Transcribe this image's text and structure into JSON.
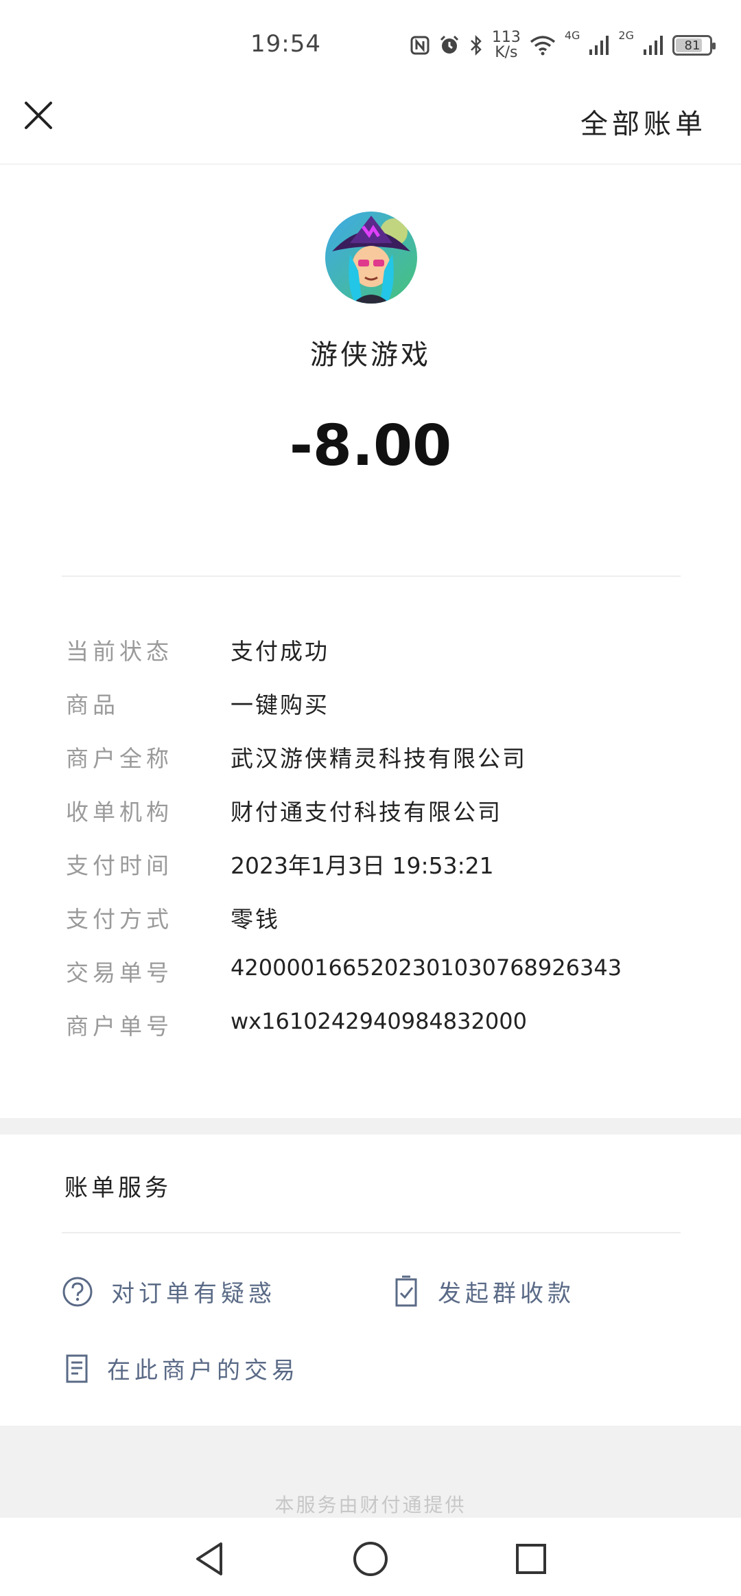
{
  "status_bar": {
    "time": "19:54",
    "net_speed_value": "113",
    "net_speed_unit": "K/s",
    "signal_1_label": "4G",
    "signal_2_label": "2G",
    "battery": "81"
  },
  "nav": {
    "all_bills": "全部账单"
  },
  "header": {
    "merchant_name": "游侠游戏",
    "amount": "-8.00"
  },
  "details": [
    {
      "label": "当前状态",
      "value": "支付成功"
    },
    {
      "label": "商品",
      "value": "一键购买"
    },
    {
      "label": "商户全称",
      "value": "武汉游侠精灵科技有限公司"
    },
    {
      "label": "收单机构",
      "value": "财付通支付科技有限公司"
    },
    {
      "label": "支付时间",
      "value": "2023年1月3日 19:53:21"
    },
    {
      "label": "支付方式",
      "value": "零钱"
    },
    {
      "label": "交易单号",
      "value": "4200001665202301030768926343"
    },
    {
      "label": "商户单号",
      "value": "wx1610242940984832000"
    }
  ],
  "services": {
    "title": "账单服务",
    "query_label": "对订单有疑惑",
    "group_collect_label": "发起群收款",
    "merchant_tx_label": "在此商户的交易"
  },
  "footer": {
    "provider_text": "本服务由财付通提供"
  },
  "icons": {
    "close": "close-icon",
    "question": "question-circle-icon",
    "checklist": "clipboard-check-icon",
    "document": "document-icon"
  },
  "colors": {
    "link": "#5a6a86",
    "label_gray": "#9a9a9a"
  }
}
